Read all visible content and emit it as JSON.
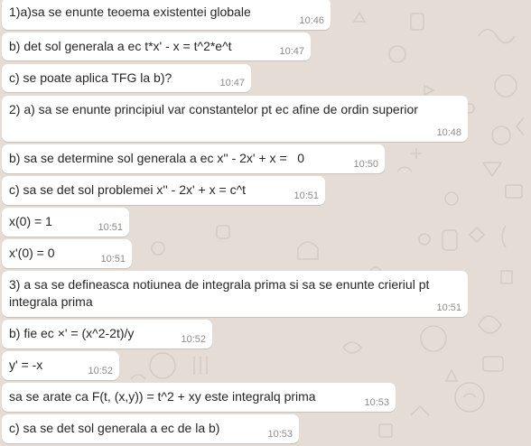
{
  "messages": [
    {
      "text": "1)a)sa se enunte teoema existentei globale",
      "time": "10:46"
    },
    {
      "text": "b) det sol generala a ec t*x' - x = t^2*e^t",
      "time": "10:47"
    },
    {
      "text": "c) se poate aplica TFG la b)?",
      "time": "10:47"
    },
    {
      "text": "2) a) sa se enunte principiul var constantelor pt ec afine de ordin superior",
      "time": "10:48"
    },
    {
      "text": "b) sa se determine sol generala a ec x'' - 2x' + x =   0",
      "time": "10:50"
    },
    {
      "text": "c) sa se det sol problemei x'' - 2x' + x = c^t",
      "time": "10:51"
    },
    {
      "text": "x(0) = 1",
      "time": "10:51"
    },
    {
      "text": "x'(0) = 0",
      "time": "10:51"
    },
    {
      "text": "3) a sa se defineasca notiunea de integrala prima si sa se enunte crieriul pt integrala prima",
      "time": "10:51"
    },
    {
      "text": "b) fie ec ×' = (x^2-2t)/y",
      "time": "10:52"
    },
    {
      "text": "y' = -x",
      "time": "10:52"
    },
    {
      "text": "sa se arate ca F(t, (x,y)) = t^2 + xy este integralq prima",
      "time": "10:53"
    },
    {
      "text": "c) sa se det sol generala a ec de la b)",
      "time": "10:53"
    }
  ],
  "colors": {
    "background": "#e5ddd5",
    "bubble": "#ffffff",
    "text": "#262626",
    "timestamp": "#8c8c8c"
  }
}
